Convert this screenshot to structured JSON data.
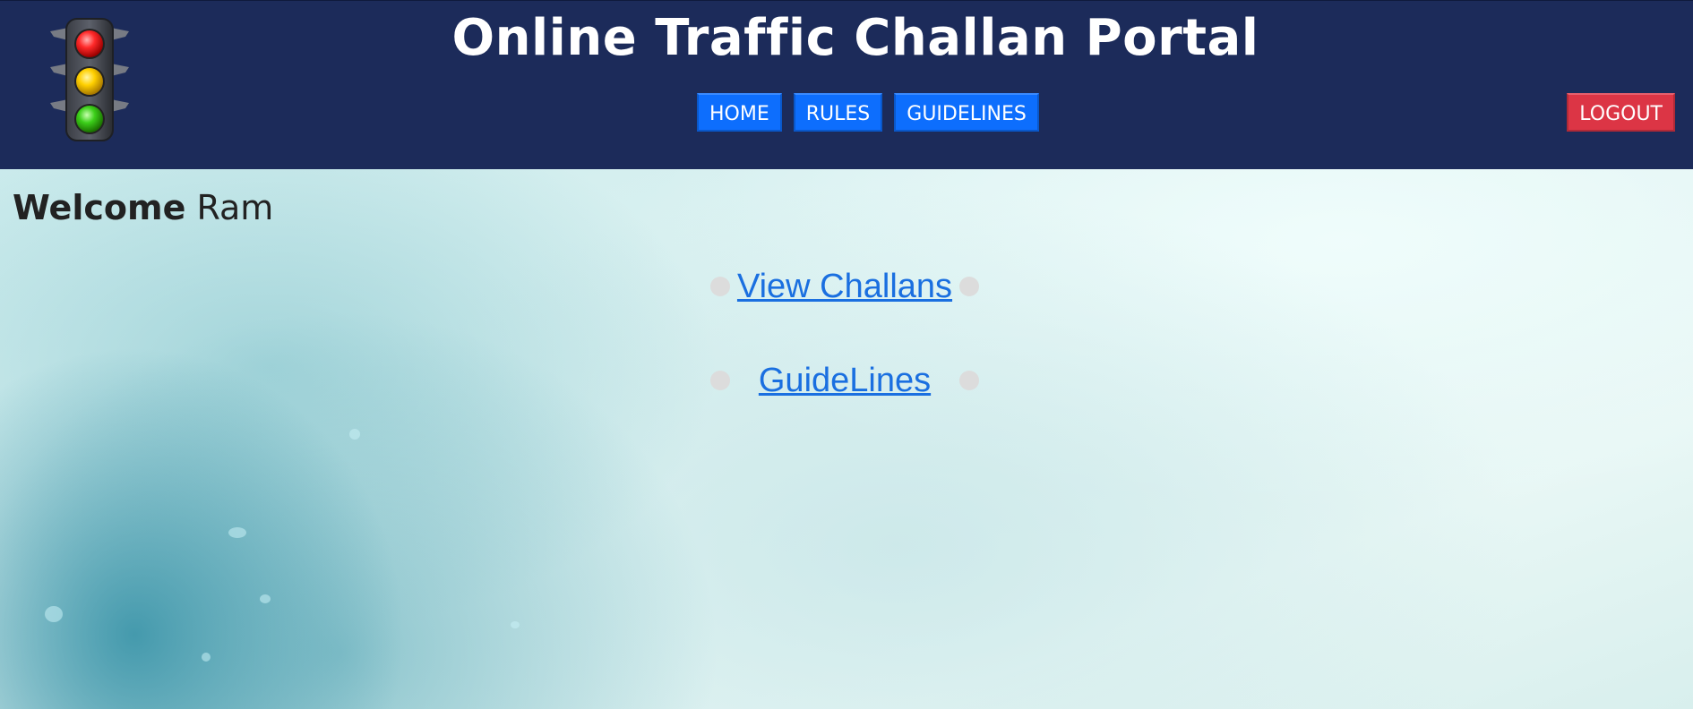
{
  "header": {
    "title": "Online Traffic Challan Portal",
    "logo_icon": "traffic-light-icon",
    "nav": [
      {
        "label": "HOME"
      },
      {
        "label": "RULES"
      },
      {
        "label": "GUIDELINES"
      }
    ],
    "logout_label": "LOGOUT"
  },
  "main": {
    "welcome_prefix": "Welcome",
    "user_name": "Ram",
    "links": [
      {
        "label": "View Challans"
      },
      {
        "label": "GuideLines"
      }
    ]
  },
  "colors": {
    "header_bg": "#1c2b5a",
    "nav_button": "#0d6efd",
    "logout_button": "#dc3545",
    "link": "#1a6fe0"
  }
}
